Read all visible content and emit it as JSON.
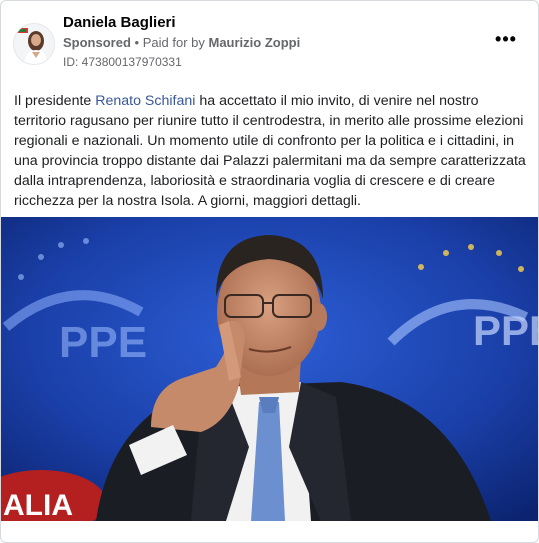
{
  "post": {
    "author": "Daniela Baglieri",
    "sponsored": "Sponsored",
    "separator": "•",
    "paid_for_prefix": "Paid for by",
    "paid_for_name": "Maurizio Zoppi",
    "ad_id": "ID: 473800137970331",
    "more_label": "•••",
    "text_part1": "Il presidente ",
    "text_link": "Renato Schifani",
    "text_part2": " ha accettato il mio invito, di venire nel nostro territorio ragusano per riunire tutto il centrodestra, in merito alle prossime elezioni regionali e nazionali. Un momento utile di confronto per la politica e i cittadini, in una provincia troppo distante dai Palazzi palermitani ma da sempre caratterizzata dalla intraprendenza, laboriosità e straordinaria voglia di crescere e di creare ricchezza per la nostra Isola. A giorni, maggiori dettagli."
  },
  "image": {
    "icon": "portrait-photo",
    "backdrop_left": "PPE",
    "backdrop_right": "PPE",
    "backdrop_bottom": "ALIA",
    "colors": {
      "background": "#0f2f8f",
      "suit": "#1a1c22",
      "shirt": "#f2f2f2",
      "tie": "#6b8fd1",
      "skin": "#c98e6e"
    }
  }
}
